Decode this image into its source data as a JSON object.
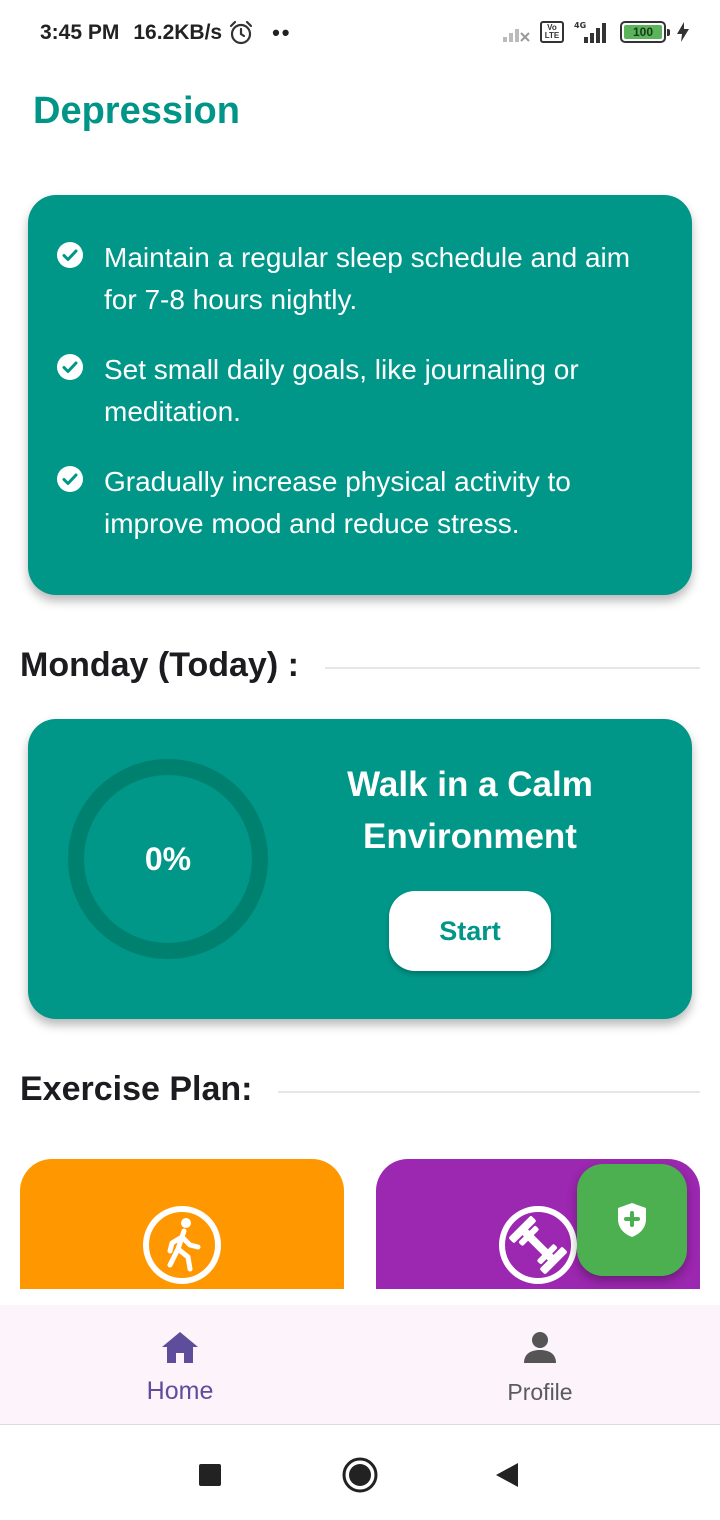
{
  "status_bar": {
    "time": "3:45 PM",
    "network_speed": "16.2KB/s",
    "dots": "••",
    "battery_level": "100",
    "icons": [
      "alarm-icon",
      "signal-no-sim-icon",
      "volte-icon",
      "signal-4g-icon",
      "battery-icon",
      "charging-icon"
    ]
  },
  "page": {
    "title": "Depression"
  },
  "tips": [
    "Maintain a regular sleep schedule and aim for 7-8 hours nightly.",
    "Set small daily goals, like journaling or meditation.",
    "Gradually increase physical activity to improve mood and reduce stress."
  ],
  "today": {
    "heading": "Monday (Today) :",
    "progress_label": "0%",
    "progress_value": 0,
    "activity": "Walk in a Calm Environment",
    "start_label": "Start"
  },
  "exercise": {
    "heading": "Exercise Plan:",
    "tiles": [
      {
        "icon": "walking-icon",
        "color": "#ff9700"
      },
      {
        "icon": "dumbbell-icon",
        "color": "#9c27b0"
      }
    ]
  },
  "fab": {
    "icon": "shield-plus-icon",
    "color": "#4caf50"
  },
  "bottom_nav": {
    "items": [
      {
        "label": "Home",
        "icon": "home-icon",
        "active": true
      },
      {
        "label": "Profile",
        "icon": "person-icon",
        "active": false
      }
    ]
  },
  "colors": {
    "accent": "#009688",
    "title": "#009587",
    "nav_active": "#5d4d9a"
  }
}
